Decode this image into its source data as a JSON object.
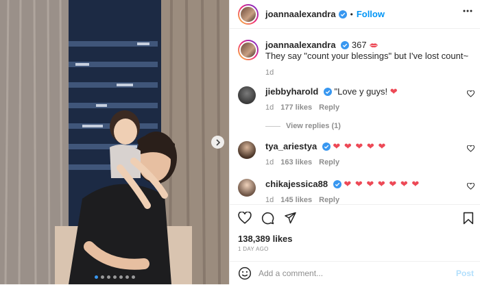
{
  "header": {
    "username": "joannaalexandra",
    "follow_label": "Follow",
    "separator": "•"
  },
  "caption": {
    "username": "joannaalexandra",
    "count": "367",
    "text": "They say \"count your blessings\" but I've lost count~",
    "age": "1d"
  },
  "comments": [
    {
      "username": "jiebbyharold",
      "text": "\"Love y guys!",
      "hearts": "❤",
      "age": "1d",
      "likes": "177 likes",
      "reply": "Reply"
    },
    {
      "username": "tya_ariestya",
      "text": "",
      "hearts": "❤ ❤ ❤ ❤ ❤",
      "age": "1d",
      "likes": "163 likes",
      "reply": "Reply"
    },
    {
      "username": "chikajessica88",
      "text": "",
      "hearts": "❤ ❤ ❤ ❤ ❤ ❤ ❤",
      "age": "1d",
      "likes": "145 likes",
      "reply": "Reply"
    }
  ],
  "view_replies": "View replies (1)",
  "post": {
    "likes": "138,389 likes",
    "date": "1 DAY AGO"
  },
  "add_comment": {
    "placeholder": "Add a comment...",
    "post_label": "Post"
  },
  "icons": {
    "verified": "verified-badge-icon",
    "more": "more-options-icon",
    "like": "heart-icon",
    "comment": "comment-icon",
    "share": "share-icon",
    "save": "bookmark-icon",
    "emoji": "emoji-icon",
    "next": "chevron-right-icon"
  },
  "colors": {
    "accent": "#0095f6",
    "heart": "#ed4956",
    "muted": "#8e8e8e"
  },
  "carousel": {
    "slides": 7,
    "active": 1
  }
}
